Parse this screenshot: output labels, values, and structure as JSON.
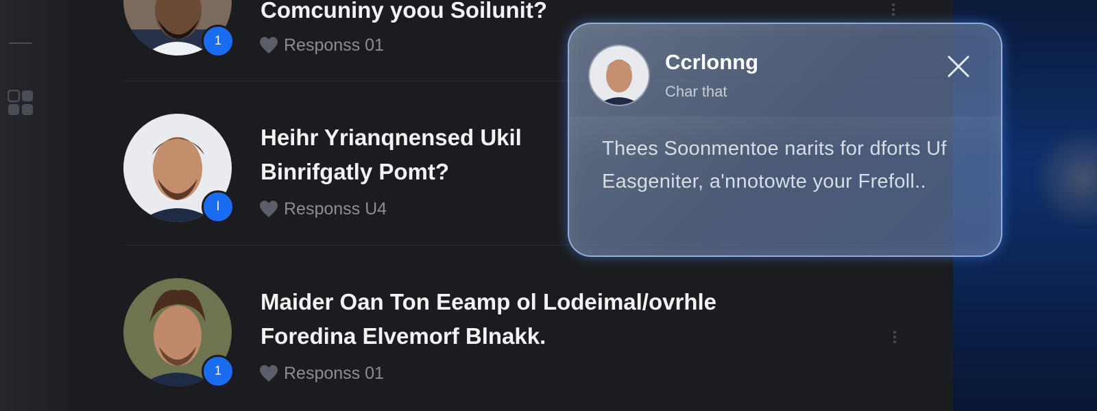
{
  "posts": [
    {
      "title": "Comcuniny yoou Soilunit?",
      "responses": "Responss  01",
      "badge": "1"
    },
    {
      "title": "Heihr Yrianqnensed Ukil Binrifgatly Pomt?",
      "responses": "Responss  U4",
      "badge": "l"
    },
    {
      "title": "Maider Oan Ton Eeamp ol Lodeimal/ovrhle Foredina Elvemorf Blnakk.",
      "responses": "Responss  01",
      "badge": "1"
    }
  ],
  "popup": {
    "name": "Ccrlonng",
    "subtitle": "Char that",
    "body": "Thees Soonmentoe narits for dforts Uf Easgeniter, a'nnotowte your Frefoll..",
    "close_icon": "close-icon"
  },
  "colors": {
    "accent": "#1a6df0",
    "panel": "#1b1c20",
    "rail": "#24262b"
  }
}
